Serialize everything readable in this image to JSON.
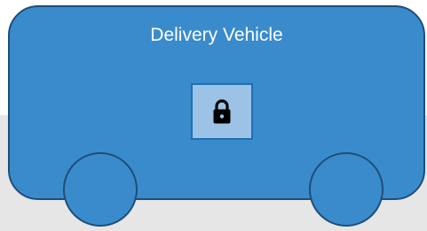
{
  "vehicle": {
    "title": "Delivery Vehicle",
    "lock_icon": "lock-icon",
    "colors": {
      "body": "#3a8bcc",
      "outline": "#1f4e79",
      "lock_box": "#9cc3e6",
      "ground": "#e6e6e6",
      "title_text": "#ffffff"
    }
  }
}
